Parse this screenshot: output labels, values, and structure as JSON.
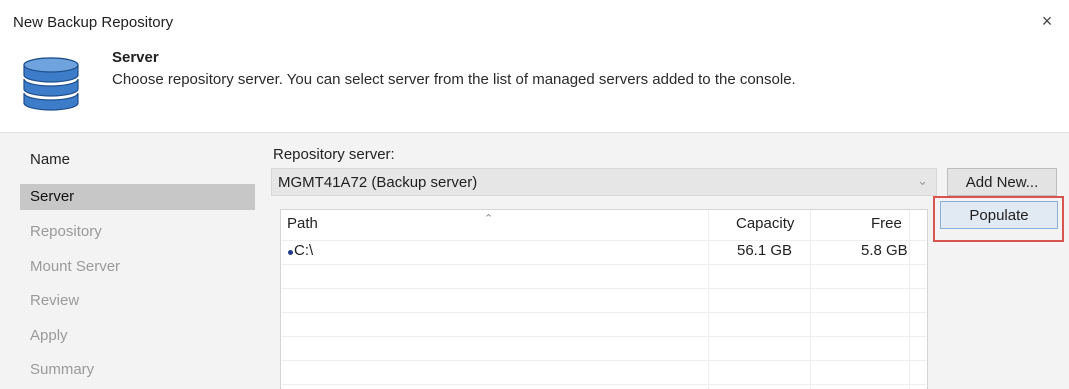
{
  "window": {
    "title": "New Backup Repository",
    "close_glyph": "×"
  },
  "header": {
    "icon": "database-icon",
    "step_title": "Server",
    "step_description": "Choose repository server. You can select server from the list of managed servers added to the console."
  },
  "nav": {
    "items": [
      {
        "label": "Name",
        "state": "done"
      },
      {
        "label": "Server",
        "state": "active"
      },
      {
        "label": "Repository",
        "state": "pending"
      },
      {
        "label": "Mount Server",
        "state": "pending"
      },
      {
        "label": "Review",
        "state": "pending"
      },
      {
        "label": "Apply",
        "state": "pending"
      },
      {
        "label": "Summary",
        "state": "pending"
      }
    ]
  },
  "server": {
    "label": "Repository server:",
    "selected": "MGMT41A72 (Backup server)",
    "add_new_label": "Add New...",
    "populate_label": "Populate"
  },
  "table": {
    "columns": [
      "Path",
      "Capacity",
      "Free"
    ],
    "rows": [
      {
        "path": "C:\\",
        "capacity": "56.1 GB",
        "free": "5.8 GB"
      }
    ]
  },
  "colors": {
    "nav_active_bg": "#c7c7c7",
    "highlight_border": "#d9534f",
    "db_icon_fill": "#3d7cc9"
  }
}
